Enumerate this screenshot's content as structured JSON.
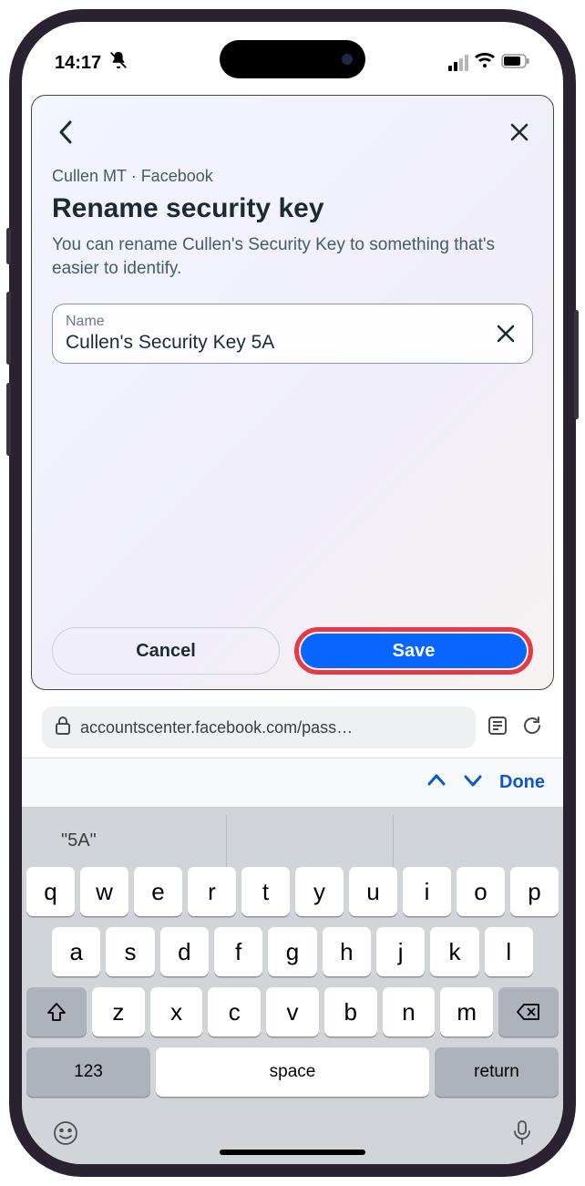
{
  "status": {
    "time": "14:17"
  },
  "page": {
    "breadcrumb": "Cullen MT · Facebook",
    "title": "Rename security key",
    "description": "You can rename Cullen's Security Key to something that's easier to identify.",
    "input_label": "Name",
    "input_value": "Cullen's Security Key 5A",
    "cancel": "Cancel",
    "save": "Save"
  },
  "addr": {
    "url": "accountscenter.facebook.com/pass…"
  },
  "accessory": {
    "done": "Done"
  },
  "kbd": {
    "suggestion": "\"5A\"",
    "row1": [
      "q",
      "w",
      "e",
      "r",
      "t",
      "y",
      "u",
      "i",
      "o",
      "p"
    ],
    "row2": [
      "a",
      "s",
      "d",
      "f",
      "g",
      "h",
      "j",
      "k",
      "l"
    ],
    "row3": [
      "z",
      "x",
      "c",
      "v",
      "b",
      "n",
      "m"
    ],
    "n123": "123",
    "space": "space",
    "ret": "return"
  }
}
